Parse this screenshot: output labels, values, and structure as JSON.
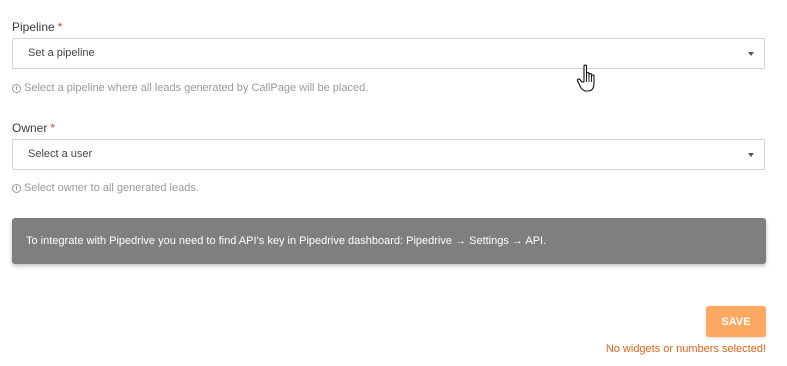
{
  "pipeline": {
    "label": "Pipeline",
    "required_mark": "*",
    "selected": "Set a pipeline",
    "help": "Select a pipeline where all leads generated by CallPage will be placed."
  },
  "owner": {
    "label": "Owner",
    "required_mark": "*",
    "selected": "Select a user",
    "help": "Select owner to all generated leads."
  },
  "notice": {
    "text": "To integrate with Pipedrive you need to find API’s key in Pipedrive dashboard: Pipedrive → Settings → API."
  },
  "actions": {
    "save_label": "SAVE",
    "error": "No widgets or numbers selected!"
  },
  "icons": {
    "help": "info-icon",
    "dropdown": "chevron-down-icon",
    "pointer": "hand-cursor-icon"
  },
  "colors": {
    "required": "#e0413a",
    "save_button": "#fba961",
    "error_text": "#e0641a",
    "notice_bg": "#7f7f7f"
  }
}
